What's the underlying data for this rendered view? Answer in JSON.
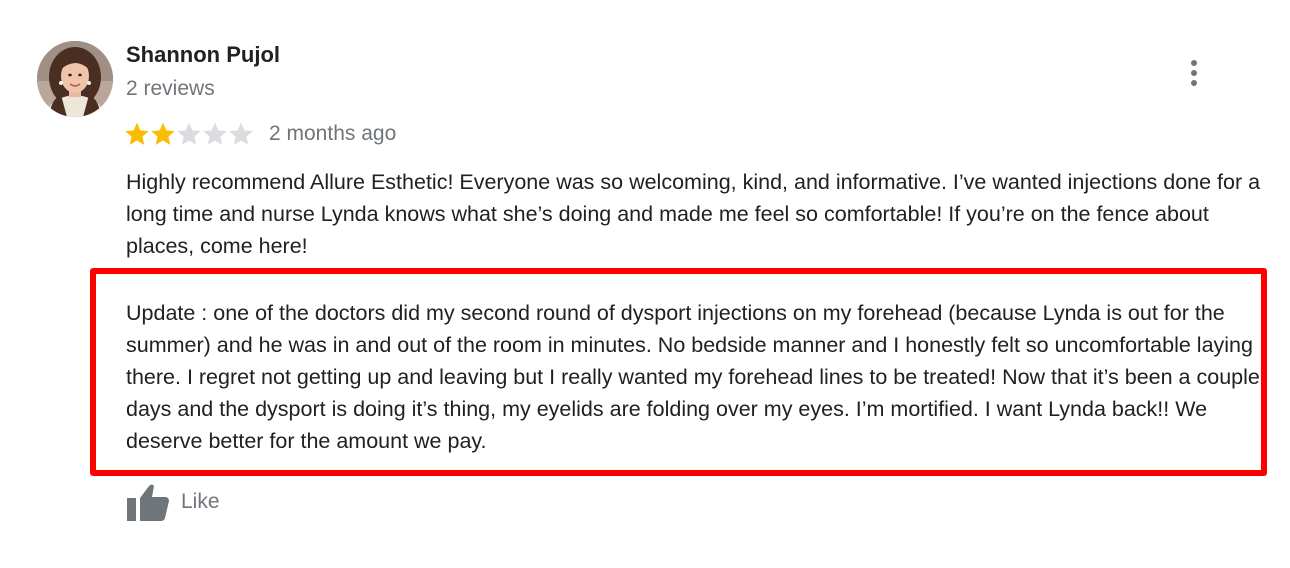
{
  "review": {
    "reviewer_name": "Shannon Pujol",
    "review_count": "2 reviews",
    "rating": 2,
    "rating_max": 5,
    "date": "2 months ago",
    "paragraphs": [
      "Highly recommend Allure Esthetic! Everyone was so welcoming, kind, and informative. I’ve wanted injections done for a long time and nurse Lynda knows what she’s doing and made me feel so comfortable! If you’re on the fence about places, come here!",
      "Update : one of the doctors did my second round of dysport injections on my forehead (because Lynda is out for the summer) and he was in and out of the room in minutes. No bedside manner and I honestly felt so uncomfortable laying there. I regret not getting up and leaving but I really wanted my forehead lines to be treated! Now that it’s been a couple days and the dysport is doing it’s thing, my eyelids are folding over my eyes. I’m mortified. I want Lynda back!! We deserve better for the amount we pay."
    ],
    "like_label": "Like"
  },
  "icons": {
    "avatar": "reviewer-avatar-photo",
    "more": "more-vertical-icon",
    "star_filled": "star-filled-icon",
    "star_empty": "star-empty-icon",
    "like": "thumbs-up-icon"
  },
  "colors": {
    "star_filled": "#fbbc04",
    "star_empty": "#dadce0",
    "secondary_text": "#70757a",
    "highlight_border": "#ff0000"
  }
}
